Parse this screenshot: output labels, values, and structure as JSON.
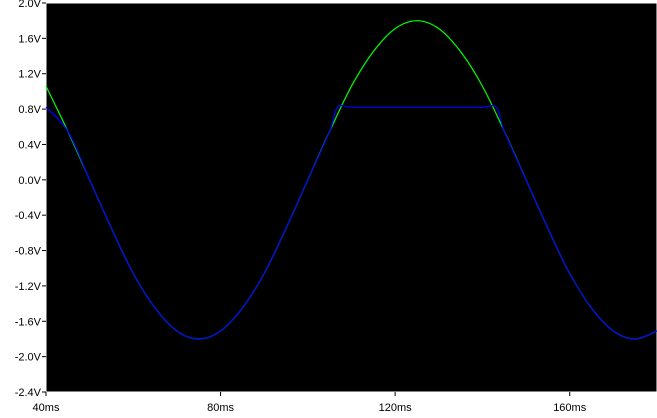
{
  "chart_data": {
    "type": "line",
    "title": "",
    "xlabel": "",
    "ylabel": "",
    "xlim": [
      40,
      180
    ],
    "ylim": [
      -2.4,
      2.0
    ],
    "grid": false,
    "x_ticks": [
      40,
      80,
      120,
      160
    ],
    "x_tick_labels": [
      "40ms",
      "80ms",
      "120ms",
      "160ms"
    ],
    "y_ticks": [
      2.0,
      1.6,
      1.2,
      0.8,
      0.4,
      0.0,
      -0.4,
      -0.8,
      -1.2,
      -1.6,
      -2.0,
      -2.4
    ],
    "y_tick_labels": [
      "2.0V",
      "1.6V",
      "1.2V",
      "0.8V",
      "0.4V",
      "0.0V",
      "-0.4V",
      "-0.8V",
      "-1.2V",
      "-1.6V",
      "-2.0V",
      "-2.4V"
    ],
    "series": [
      {
        "color": "#00ff00",
        "x": [
          40,
          45,
          50,
          55,
          60,
          65,
          70,
          75,
          80,
          85,
          90,
          95,
          100,
          105,
          110,
          115,
          120,
          125,
          130,
          135,
          140,
          145,
          150,
          155,
          160,
          165,
          170,
          175,
          180
        ],
        "y": [
          1.06,
          0.55,
          -0.0,
          -0.55,
          -1.06,
          -1.45,
          -1.71,
          -1.8,
          -1.71,
          -1.45,
          -1.06,
          -0.55,
          0.0,
          0.55,
          1.06,
          1.45,
          1.71,
          1.8,
          1.71,
          1.45,
          1.06,
          0.55,
          0.0,
          -0.55,
          -1.06,
          -1.45,
          -1.71,
          -1.8,
          -1.71
        ]
      },
      {
        "color": "#0000ff",
        "x": [
          40,
          45,
          50,
          55,
          60,
          65,
          70,
          75,
          80,
          85,
          90,
          95,
          100,
          105,
          106.8,
          110,
          115,
          120,
          125,
          130,
          135,
          140,
          143.2,
          145,
          150,
          155,
          160,
          165,
          170,
          175,
          180
        ],
        "y": [
          0.82,
          0.55,
          -0.0,
          -0.55,
          -1.06,
          -1.45,
          -1.71,
          -1.8,
          -1.71,
          -1.45,
          -1.06,
          -0.55,
          0.0,
          0.55,
          0.82,
          0.82,
          0.82,
          0.82,
          0.82,
          0.82,
          0.82,
          0.82,
          0.82,
          0.55,
          0.0,
          -0.55,
          -1.06,
          -1.45,
          -1.71,
          -1.8,
          -1.71
        ]
      }
    ]
  },
  "colors": {
    "plot_background": "#000000",
    "frame": "#ffffff",
    "tick_label": "#000000"
  }
}
